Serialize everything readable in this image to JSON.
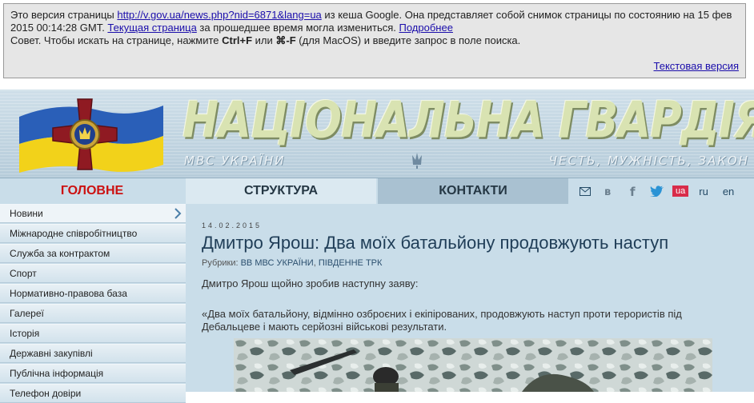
{
  "cache": {
    "line1_a": "Это версия страницы ",
    "url": "http://v.gov.ua/news.php?nid=6871&lang=ua",
    "line1_b": " из кеша Google. Она представляет собой снимок страницы по состоянию на 15 фев",
    "line2_a": "2015 00:14:28 GMT. ",
    "current_link": "Текущая страница",
    "line2_b": " за прошедшее время могла измениться. ",
    "more_link": "Подробнее",
    "tip_a": "Совет. Чтобы искать на странице, нажмите ",
    "tip_keys1": "Ctrl+F",
    "tip_or": " или ",
    "tip_keys2": "⌘-F",
    "tip_b": " (для MacOS) и введите запрос в поле поиска.",
    "text_version": "Текстовая версия"
  },
  "header": {
    "title": "НАЦІОНАЛЬНА ГВАРДІЯ УКРАЇНИ",
    "motto_left": "МВС УКРАЇНИ",
    "motto_right": "ЧЕСТЬ, МУЖНІСТЬ, ЗАКОН"
  },
  "nav": {
    "home": "ГОЛОВНЕ",
    "structure": "СТРУКТУРА",
    "contacts": "КОНТАКТИ",
    "lang_ua": "ua",
    "lang_ru": "ru",
    "lang_en": "en"
  },
  "sidebar": {
    "items": [
      {
        "label": "Новини"
      },
      {
        "label": "Міжнародне співробітництво"
      },
      {
        "label": "Служба за контрактом"
      },
      {
        "label": "Спорт"
      },
      {
        "label": "Нормативно-правова база"
      },
      {
        "label": "Галереї"
      },
      {
        "label": "Історія"
      },
      {
        "label": "Державні закупівлі"
      },
      {
        "label": "Публічна інформація"
      },
      {
        "label": "Телефон довіри"
      }
    ]
  },
  "post": {
    "date": "14.02.2015",
    "title": "Дмитро Ярош: Два моїх батальйону продовжують наступ",
    "rubrics_label": "Рубрики: ",
    "rubric1": "ВВ МВС УКРАЇНИ",
    "rubric_sep": ", ",
    "rubric2": "ПІВДЕННЕ ТРК",
    "para1": "Дмитро Ярош щойно зробив наступну заяву:",
    "para2": "«Два моїх батальйону, відмінно озброєних і екіпірованих, продовжують наступ проти терористів під Дебальцеве і мають серйозні військові результати."
  }
}
